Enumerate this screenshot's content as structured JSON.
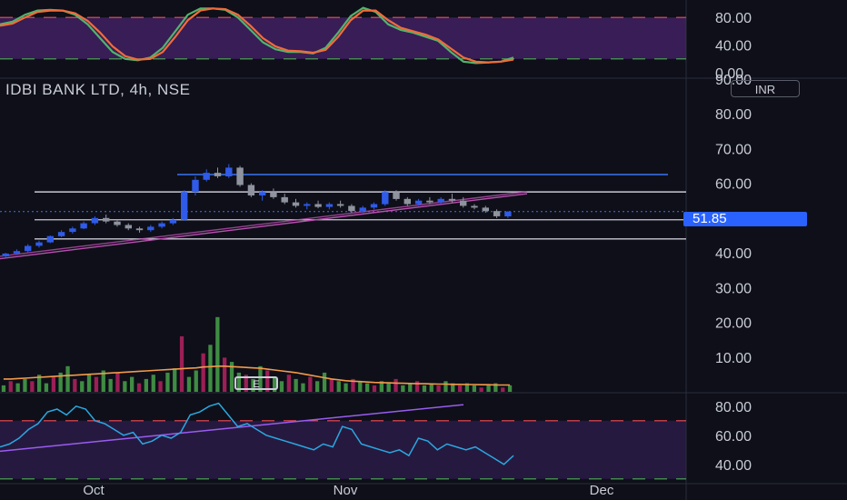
{
  "header": {
    "ticker": "IDBI BANK LTD, 4h, NSE",
    "currency": "INR"
  },
  "last_price": "51.85",
  "earnings_marker": "E",
  "colors": {
    "bg": "#0e0f18",
    "up_candle": "#2f5be8",
    "down_candle": "#8f939e",
    "support_line": "#c7c9d1",
    "resistance_line": "#3a73f0",
    "trendline": "#b94fb0",
    "vol_up": "#3f8c43",
    "vol_down": "#9c1f55",
    "vol_ma": "#f29a4a",
    "stoch_k": "#52b36d",
    "stoch_d": "#f26b3a",
    "rsi": "#2aa7e0",
    "rsi_trend": "#9a5cf0",
    "upper_band": "#f24d55",
    "lower_band": "#4caf50"
  },
  "chart_data": [
    {
      "type": "line",
      "panel": "stochastic",
      "ylim": [
        0,
        100
      ],
      "y_ticks": [
        "80.00",
        "40.00",
        "0.00"
      ],
      "band": [
        20,
        80
      ],
      "series": [
        {
          "values": [
            70,
            74,
            84,
            90,
            91,
            90,
            84,
            70,
            50,
            30,
            20,
            18,
            22,
            36,
            60,
            84,
            93,
            93,
            91,
            80,
            62,
            44,
            34,
            30,
            30,
            28,
            36,
            58,
            82,
            94,
            88,
            70,
            62,
            58,
            52,
            46,
            30,
            16,
            14,
            15,
            16,
            22
          ]
        },
        {
          "values": [
            68,
            71,
            80,
            88,
            90,
            90,
            86,
            75,
            58,
            38,
            24,
            19,
            20,
            30,
            52,
            76,
            90,
            93,
            92,
            84,
            68,
            50,
            38,
            32,
            31,
            29,
            33,
            52,
            76,
            90,
            90,
            76,
            65,
            60,
            55,
            48,
            35,
            22,
            16,
            15,
            16,
            19
          ]
        }
      ]
    },
    {
      "type": "candlestick",
      "panel": "price",
      "x_ticks": [
        "Oct",
        "Nov",
        "Dec"
      ],
      "y_ticks": [
        "90.00",
        "80.00",
        "70.00",
        "60.00",
        "50.00",
        "40.00",
        "30.00",
        "20.00",
        "10.00"
      ],
      "ylim": [
        5,
        91
      ],
      "horizontal_levels": [
        62.5,
        57.5,
        49.5,
        44
      ],
      "candles": [
        [
          39,
          40,
          38.5,
          39.8
        ],
        [
          39.8,
          41,
          39.5,
          40.5
        ],
        [
          40.5,
          42.5,
          40.2,
          42
        ],
        [
          42,
          43.5,
          41.5,
          43
        ],
        [
          43,
          45,
          42.8,
          44.8
        ],
        [
          44.8,
          46.5,
          44.5,
          46
        ],
        [
          46,
          47.5,
          45.5,
          47
        ],
        [
          47,
          49,
          46.8,
          48.5
        ],
        [
          48.5,
          50.5,
          48,
          50
        ],
        [
          50,
          51,
          48.5,
          49
        ],
        [
          49,
          49.5,
          47.5,
          48
        ],
        [
          48,
          48.5,
          46.5,
          47
        ],
        [
          47,
          47.5,
          45.8,
          46.5
        ],
        [
          46.5,
          48,
          46,
          47.5
        ],
        [
          47.5,
          49,
          47,
          48.5
        ],
        [
          48.5,
          50,
          48,
          49.5
        ],
        [
          49.5,
          58,
          49.2,
          57.5
        ],
        [
          57.5,
          62,
          56.5,
          61
        ],
        [
          61,
          64,
          60.5,
          63
        ],
        [
          63,
          64.5,
          61.5,
          62
        ],
        [
          62,
          65.5,
          61.5,
          64.5
        ],
        [
          64.5,
          65,
          59,
          59.5
        ],
        [
          59.5,
          60,
          56,
          56.5
        ],
        [
          56.5,
          58,
          55,
          57.5
        ],
        [
          57.5,
          58.5,
          55.5,
          56
        ],
        [
          56,
          57,
          54,
          54.5
        ],
        [
          54.5,
          55.5,
          53,
          53.5
        ],
        [
          53.5,
          54.5,
          52.5,
          54
        ],
        [
          54,
          55,
          52.8,
          53.2
        ],
        [
          53.2,
          54.5,
          52.5,
          54
        ],
        [
          54,
          55,
          53,
          53.5
        ],
        [
          53.5,
          54,
          51.5,
          52
        ],
        [
          52,
          53.5,
          51.5,
          53
        ],
        [
          53,
          54.5,
          52.5,
          54
        ],
        [
          54,
          58,
          53.5,
          57.5
        ],
        [
          57.5,
          58,
          55,
          55.5
        ],
        [
          55.5,
          56,
          53.5,
          54
        ],
        [
          54,
          55.5,
          53.5,
          55
        ],
        [
          55,
          56,
          54,
          54.5
        ],
        [
          54.5,
          56,
          54,
          55.5
        ],
        [
          55.5,
          57,
          54.5,
          55
        ],
        [
          55,
          56,
          53,
          53.5
        ],
        [
          53.5,
          54,
          52.5,
          53
        ],
        [
          53,
          53.5,
          51.5,
          52
        ],
        [
          52,
          52.5,
          50,
          50.5
        ],
        [
          50.5,
          52,
          50,
          51.85
        ]
      ]
    },
    {
      "type": "bar",
      "panel": "volume",
      "values": [
        3,
        5,
        4,
        6,
        5,
        8,
        4,
        7,
        9,
        12,
        6,
        5,
        8,
        7,
        10,
        6,
        9,
        5,
        7,
        4,
        6,
        8,
        5,
        9,
        11,
        26,
        7,
        10,
        18,
        22,
        35,
        16,
        14,
        9,
        8,
        6,
        12,
        10,
        7,
        5,
        8,
        6,
        4,
        7,
        5,
        9,
        6,
        5,
        4,
        6,
        5,
        4,
        3,
        5,
        4,
        6,
        3,
        4,
        5,
        3,
        4,
        3,
        5,
        4,
        3,
        4,
        3,
        2,
        3,
        4,
        2,
        3
      ],
      "ma": [
        6,
        6,
        6.2,
        6.4,
        6.6,
        6.8,
        7,
        7.2,
        7.4,
        7.6,
        7.8,
        8,
        8.2,
        8.4,
        8.6,
        8.8,
        9,
        9.2,
        9.4,
        9.6,
        9.8,
        10,
        10.2,
        10.4,
        10.6,
        10.8,
        11,
        11.2,
        11.6,
        11.8,
        12,
        12,
        11.8,
        11.6,
        11.4,
        11.2,
        11,
        10.6,
        10.2,
        9.8,
        9.4,
        9,
        8.4,
        7.8,
        7.2,
        6.6,
        6,
        5.6,
        5.2,
        5,
        4.8,
        4.6,
        4.4,
        4.3,
        4.2,
        4.1,
        4,
        3.9,
        3.8,
        3.8,
        3.7,
        3.6,
        3.6,
        3.5,
        3.5,
        3.4,
        3.4,
        3.3,
        3.3,
        3.2,
        3.2,
        3.2
      ]
    },
    {
      "type": "line",
      "panel": "rsi",
      "ylim": [
        28,
        88
      ],
      "y_ticks": [
        "80.00",
        "60.00",
        "40.00"
      ],
      "band": [
        30,
        70
      ],
      "series": [
        {
          "values": [
            52,
            54,
            58,
            64,
            68,
            76,
            78,
            74,
            80,
            78,
            70,
            68,
            64,
            60,
            62,
            54,
            56,
            60,
            58,
            62,
            74,
            76,
            80,
            82,
            74,
            66,
            68,
            64,
            60,
            58,
            56,
            54,
            52,
            50,
            54,
            52,
            66,
            64,
            54,
            52,
            50,
            48,
            50,
            46,
            58,
            56,
            50,
            54,
            52,
            50,
            52,
            48,
            44,
            40,
            46
          ]
        }
      ]
    }
  ]
}
